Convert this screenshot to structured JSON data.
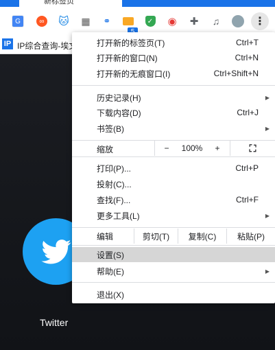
{
  "browser": {
    "active_tab_title": "新标签页",
    "extension_badge": "5"
  },
  "bookmarks": {
    "items": [
      {
        "icon": "IP",
        "label": "IP综合查询-埃文"
      }
    ]
  },
  "page": {
    "tile_label": "Twitter"
  },
  "menu": {
    "group1": [
      {
        "label": "打开新的标签页(T)",
        "shortcut": "Ctrl+T"
      },
      {
        "label": "打开新的窗口(N)",
        "shortcut": "Ctrl+N"
      },
      {
        "label": "打开新的无痕窗口(I)",
        "shortcut": "Ctrl+Shift+N"
      }
    ],
    "group2": [
      {
        "label": "历史记录(H)",
        "shortcut": "",
        "submenu": true
      },
      {
        "label": "下载内容(D)",
        "shortcut": "Ctrl+J"
      },
      {
        "label": "书签(B)",
        "shortcut": "",
        "submenu": true
      }
    ],
    "zoom": {
      "label": "缩放",
      "minus": "−",
      "value": "100%",
      "plus": "+",
      "fullscreen": "⛶"
    },
    "group3": [
      {
        "label": "打印(P)...",
        "shortcut": "Ctrl+P"
      },
      {
        "label": "投射(C)...",
        "shortcut": ""
      },
      {
        "label": "查找(F)...",
        "shortcut": "Ctrl+F"
      },
      {
        "label": "更多工具(L)",
        "shortcut": "",
        "submenu": true
      }
    ],
    "edit": {
      "label": "编辑",
      "cut": "剪切(T)",
      "copy": "复制(C)",
      "paste": "粘贴(P)"
    },
    "group4": [
      {
        "label": "设置(S)",
        "highlighted": true
      },
      {
        "label": "帮助(E)",
        "submenu": true
      }
    ],
    "exit": {
      "label": "退出(X)"
    }
  }
}
